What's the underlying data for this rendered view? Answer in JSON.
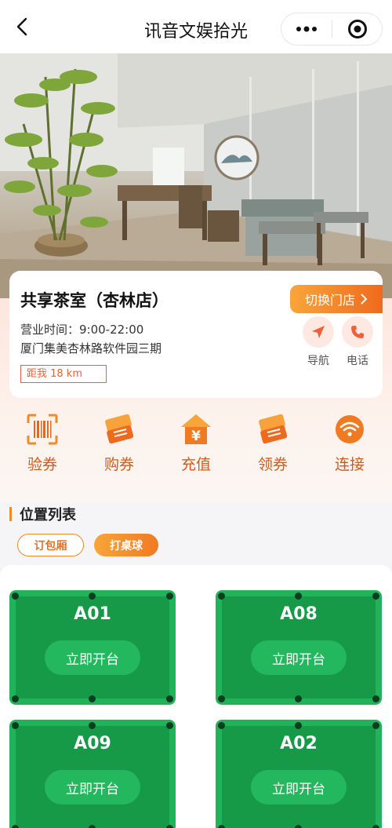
{
  "header": {
    "title": "讯音文娱拾光"
  },
  "store": {
    "name": "共享茶室（杏林店）",
    "switch_label": "切换门店",
    "hours": "营业时间：9:00-22:00",
    "address": "厦门集美杏林路软件园三期",
    "distance": "距我 18 km",
    "actions": [
      {
        "label": "导航",
        "icon": "paper-plane-icon"
      },
      {
        "label": "电话",
        "icon": "phone-icon"
      }
    ]
  },
  "menu": [
    {
      "label": "验券",
      "icon": "barcode-scan-icon"
    },
    {
      "label": "购券",
      "icon": "ticket-icon"
    },
    {
      "label": "充值",
      "icon": "yuan-house-icon"
    },
    {
      "label": "领券",
      "icon": "ticket-icon"
    },
    {
      "label": "连接",
      "icon": "wifi-icon"
    }
  ],
  "section": {
    "title": "位置列表"
  },
  "tabs": [
    {
      "label": "订包厢",
      "active": false
    },
    {
      "label": "打桌球",
      "active": true
    }
  ],
  "tables": [
    {
      "code": "A01",
      "action": "立即开台"
    },
    {
      "code": "A08",
      "action": "立即开台"
    },
    {
      "code": "A09",
      "action": "立即开台"
    },
    {
      "code": "A02",
      "action": "立即开台"
    }
  ],
  "colors": {
    "accent": "#f08a2a",
    "table_green": "#20b35a",
    "menu_text": "#d45a18"
  }
}
